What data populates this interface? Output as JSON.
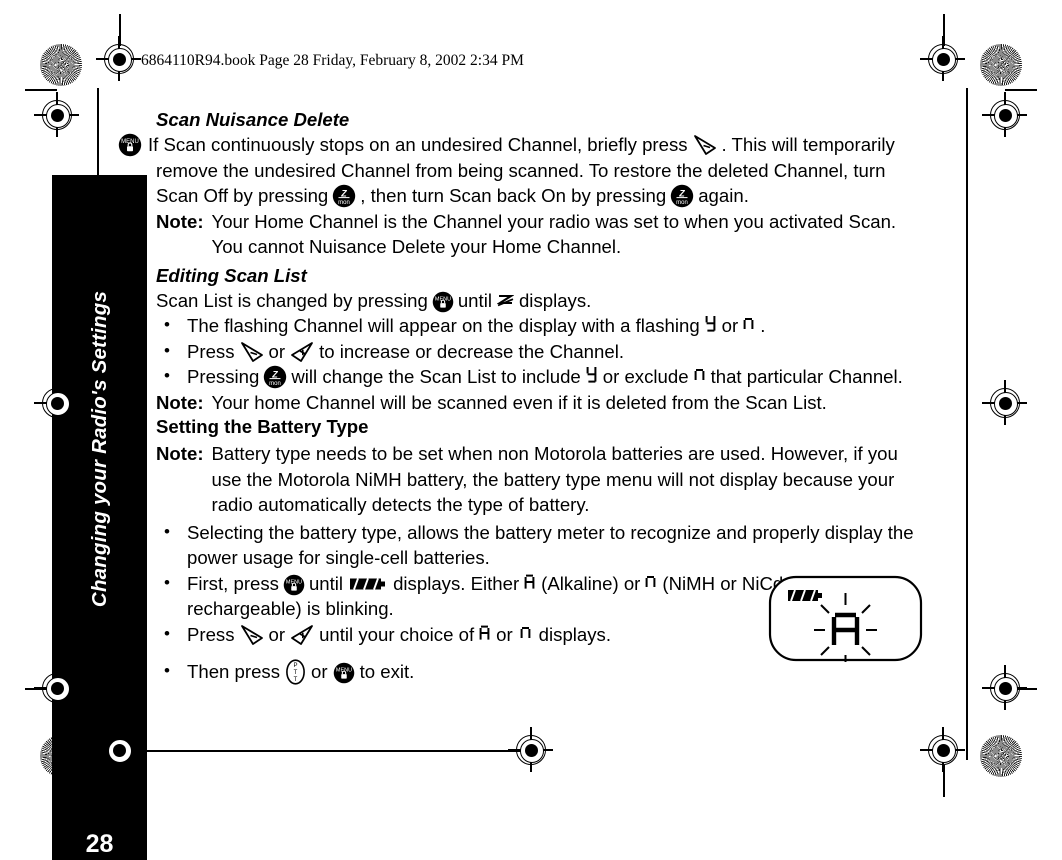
{
  "document": {
    "header_line": "6864110R94.book  Page 28  Friday, February 8, 2002  2:34 PM",
    "page_number": "28",
    "side_tab_label": "Changing your Radio's Settings"
  },
  "sections": {
    "scan_nuisance_delete": {
      "heading": "Scan Nuisance Delete",
      "body_1": "If Scan continuously stops on an undesired Channel, briefly press",
      "body_2": ". This will temporarily remove the undesired Channel from being scanned. To restore the deleted Channel, turn Scan Off by pressing",
      "body_3": ", then turn Scan back On by pressing",
      "body_4": "again.",
      "note_label": "Note:",
      "note_text": "Your Home Channel is the Channel your radio was set to when you activated Scan. You cannot Nuisance Delete your Home Channel."
    },
    "editing_scan_list": {
      "heading": "Editing Scan List",
      "intro_1": "Scan List is changed by pressing",
      "intro_2": "until",
      "intro_3": "displays.",
      "bullets": [
        {
          "part_1": "The flashing Channel will appear on the display with a flashing",
          "part_2": "or",
          "part_3": "."
        },
        {
          "part_1": "Press",
          "part_2": "or",
          "part_3": "to increase or decrease the Channel."
        },
        {
          "part_1": "Pressing",
          "part_2": "will change the Scan List to include",
          "part_3": "or exclude",
          "part_4": "that particular Channel."
        }
      ],
      "note_label": "Note:",
      "note_text": "Your home Channel will be scanned even if it is deleted from the Scan List."
    },
    "setting_battery_type": {
      "heading": "Setting the Battery Type",
      "note_label": "Note:",
      "note_text": "Battery type needs to be set when non Motorola batteries are used. However, if you use the Motorola NiMH battery, the battery type menu will not display because your radio automatically detects the type of battery.",
      "bullets": [
        {
          "part_1": "Selecting the battery type, allows the battery meter to recognize and properly display the power usage for single-cell batteries."
        },
        {
          "part_1": "First, press",
          "part_2": "until",
          "part_3": "displays. Either",
          "part_4": "(Alkaline) or",
          "part_5": "(NiMH or NiCd rechargeable) is blinking."
        },
        {
          "part_1": "Press",
          "part_2": "or",
          "part_3": "until your choice of",
          "part_4": "or",
          "part_5": "displays."
        },
        {
          "part_1": "Then press",
          "part_2": "or",
          "part_3": "to exit."
        }
      ]
    }
  },
  "icons": {
    "menu_key": "menu-lock-key-icon",
    "mon_key": "monitor-scan-key-icon",
    "ptt_key": "ptt-key-icon",
    "down_arrow_key": "down-decrease-arrow-icon",
    "up_arrow_key": "up-increase-arrow-icon",
    "scan_symbol": "scan-list-symbol-icon",
    "battery_meter": "battery-meter-icon",
    "lcd_y": "lcd-char-y",
    "lcd_n": "lcd-char-n",
    "lcd_a": "lcd-char-a"
  },
  "lcd_illustration": {
    "name": "radio-lcd-display",
    "battery_bars": 3,
    "character": "A",
    "blinking": true
  },
  "colors": {
    "ink": "#000000",
    "paper": "#ffffff",
    "tab_background": "#000000",
    "tab_text": "#ffffff"
  }
}
